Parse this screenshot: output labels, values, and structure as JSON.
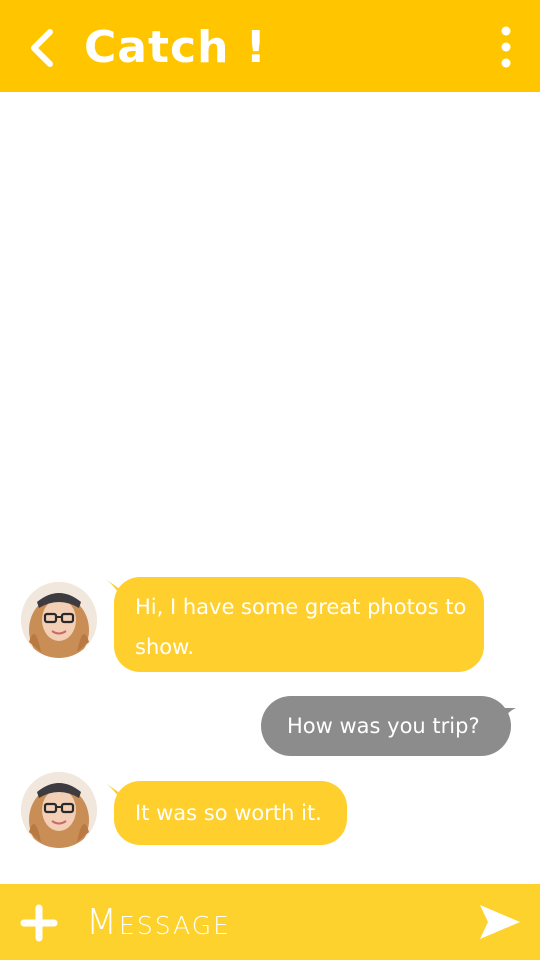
{
  "header": {
    "title": "Catch !",
    "back_icon": "chevron-left-icon",
    "menu_icon": "more-vertical-icon"
  },
  "messages": [
    {
      "direction": "incoming",
      "text": "Hi, I have some great photos to show."
    },
    {
      "direction": "outgoing",
      "text": "How was you trip?"
    },
    {
      "direction": "incoming",
      "text": "It was so worth it."
    }
  ],
  "composer": {
    "placeholder": "Message",
    "add_icon": "plus-icon",
    "send_icon": "send-icon"
  },
  "colors": {
    "header": "#ffc600",
    "incoming_bubble": "#ffcf2e",
    "outgoing_bubble": "#8c8c8c",
    "footer": "#fed22d",
    "text_on_color": "#ffffff"
  }
}
